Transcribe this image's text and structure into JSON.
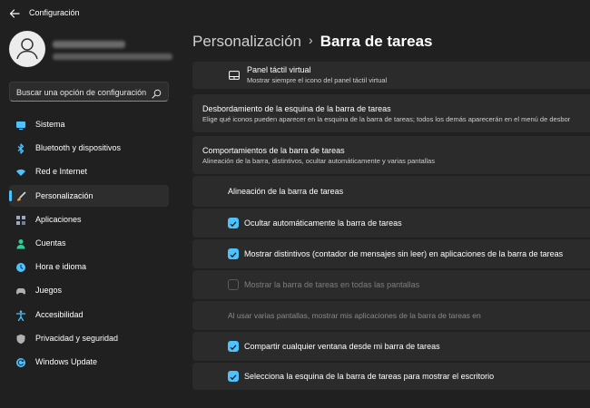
{
  "app": {
    "title": "Configuración"
  },
  "search": {
    "placeholder": "Buscar una opción de configuración"
  },
  "sidebar": {
    "items": [
      {
        "label": "Sistema",
        "icon": "monitor-icon",
        "color": "#4cc2ff"
      },
      {
        "label": "Bluetooth y dispositivos",
        "icon": "bluetooth-icon",
        "color": "#4cc2ff"
      },
      {
        "label": "Red e Internet",
        "icon": "wifi-icon",
        "color": "#4cc2ff"
      },
      {
        "label": "Personalización",
        "icon": "brush-icon",
        "color": "#f0a030",
        "selected": true
      },
      {
        "label": "Aplicaciones",
        "icon": "apps-icon",
        "color": "#9aa8c0"
      },
      {
        "label": "Cuentas",
        "icon": "person-icon",
        "color": "#2ecc9a"
      },
      {
        "label": "Hora e idioma",
        "icon": "globe-clock-icon",
        "color": "#4cc2ff"
      },
      {
        "label": "Juegos",
        "icon": "gamepad-icon",
        "color": "#b0b0b0"
      },
      {
        "label": "Accesibilidad",
        "icon": "accessibility-icon",
        "color": "#4cc2ff"
      },
      {
        "label": "Privacidad y seguridad",
        "icon": "shield-icon",
        "color": "#b0b0b0"
      },
      {
        "label": "Windows Update",
        "icon": "update-icon",
        "color": "#4cc2ff"
      }
    ]
  },
  "header": {
    "parent": "Personalización",
    "separator": "›",
    "current": "Barra de tareas"
  },
  "main": {
    "touchpad": {
      "title": "Panel táctil virtual",
      "desc": "Mostrar siempre el icono del panel táctil virtual"
    },
    "overflow": {
      "title": "Desbordamiento de la esquina de la barra de tareas",
      "desc": "Elige qué iconos pueden aparecer en la esquina de la barra de tareas; todos los demás aparecerán en el menú de desbor"
    },
    "behaviors": {
      "title": "Comportamientos de la barra de tareas",
      "desc": "Alineación de la barra, distintivos, ocultar automáticamente y varias pantallas",
      "alignment_label": "Alineación de la barra de tareas",
      "options": [
        {
          "label": "Ocultar automáticamente la barra de tareas",
          "checked": true,
          "enabled": true
        },
        {
          "label": "Mostrar distintivos (contador de mensajes sin leer) en aplicaciones de la barra de tareas",
          "checked": true,
          "enabled": true
        },
        {
          "label": "Mostrar la barra de tareas en todas las pantallas",
          "checked": false,
          "enabled": false
        }
      ],
      "multi_display_label": "Al usar varias pantallas, mostrar mis aplicaciones de la barra de tareas en",
      "options2": [
        {
          "label": "Compartir cualquier ventana desde mi barra de tareas",
          "checked": true,
          "enabled": true
        },
        {
          "label": "Selecciona la esquina de la barra de tareas para mostrar el escritorio",
          "checked": true,
          "enabled": true
        }
      ]
    }
  }
}
